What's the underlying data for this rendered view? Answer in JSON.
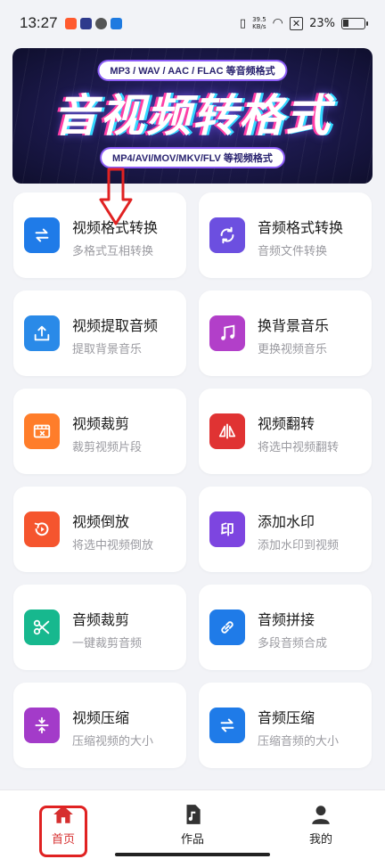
{
  "status_bar": {
    "time": "13:27",
    "speed_value": "39.5",
    "speed_unit": "KB/s",
    "battery": "23%"
  },
  "banner": {
    "top_pill": "MP3 / WAV / AAC / FLAC 等音频格式",
    "title": "音视频转格式",
    "bottom_pill": "MP4/AVI/MOV/MKV/FLV 等视频格式"
  },
  "features": [
    {
      "title": "视频格式转换",
      "subtitle": "多格式互相转换",
      "icon": "swap-icon",
      "color": "#1f7be8"
    },
    {
      "title": "音频格式转换",
      "subtitle": "音频文件转换",
      "icon": "refresh-icon",
      "color": "#6c4fe0"
    },
    {
      "title": "视频提取音频",
      "subtitle": "提取背景音乐",
      "icon": "upload-tray-icon",
      "color": "#2a8ae8"
    },
    {
      "title": "换背景音乐",
      "subtitle": "更换视频音乐",
      "icon": "music-note-icon",
      "color": "#b23fc9"
    },
    {
      "title": "视频裁剪",
      "subtitle": "裁剪视频片段",
      "icon": "film-cut-icon",
      "color": "#ff7d2a"
    },
    {
      "title": "视频翻转",
      "subtitle": "将选中视频翻转",
      "icon": "flip-icon",
      "color": "#e03333"
    },
    {
      "title": "视频倒放",
      "subtitle": "将选中视频倒放",
      "icon": "reverse-play-icon",
      "color": "#f5552e"
    },
    {
      "title": "添加水印",
      "subtitle": "添加水印到视频",
      "icon": "watermark-stamp-icon",
      "color": "#7d45e0"
    },
    {
      "title": "音频裁剪",
      "subtitle": "一键裁剪音频",
      "icon": "scissors-icon",
      "color": "#17b88e"
    },
    {
      "title": "音频拼接",
      "subtitle": "多段音频合成",
      "icon": "link-icon",
      "color": "#1f7be8"
    },
    {
      "title": "视频压缩",
      "subtitle": "压缩视频的大小",
      "icon": "compress-icon",
      "color": "#a33bc9"
    },
    {
      "title": "音频压缩",
      "subtitle": "压缩音频的大小",
      "icon": "swap-icon",
      "color": "#1f7be8"
    }
  ],
  "nav": {
    "home": "首页",
    "works": "作品",
    "mine": "我的"
  }
}
